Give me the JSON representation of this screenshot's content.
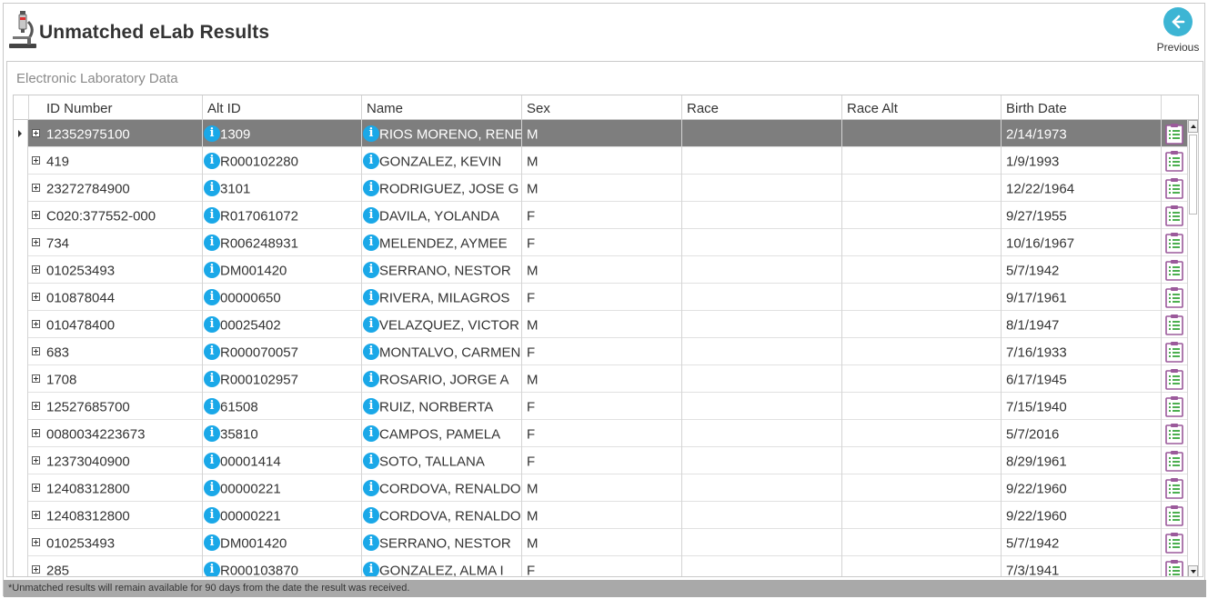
{
  "header": {
    "title": "Unmatched eLab Results",
    "previous_label": "Previous",
    "app_icon": "microscope-icon",
    "previous_icon": "arrow-left-icon"
  },
  "panel": {
    "title": "Electronic Laboratory Data"
  },
  "grid": {
    "columns": [
      "ID Number",
      "Alt ID",
      "Name",
      "Sex",
      "Race",
      "Race Alt",
      "Birth Date"
    ],
    "selected_row": 0,
    "rows": [
      {
        "id": "12352975100",
        "alt_id": "1309",
        "name": "RIOS MORENO, RENE",
        "sex": "M",
        "race": "",
        "race_alt": "",
        "birth": "2/14/1973"
      },
      {
        "id": "419",
        "alt_id": "R000102280",
        "name": "GONZALEZ, KEVIN",
        "sex": "M",
        "race": "",
        "race_alt": "",
        "birth": "1/9/1993"
      },
      {
        "id": "23272784900",
        "alt_id": "3101",
        "name": "RODRIGUEZ, JOSE G",
        "sex": "M",
        "race": "",
        "race_alt": "",
        "birth": "12/22/1964"
      },
      {
        "id": "C020:377552-000",
        "alt_id": "R017061072",
        "name": "DAVILA, YOLANDA",
        "sex": "F",
        "race": "",
        "race_alt": "",
        "birth": "9/27/1955"
      },
      {
        "id": "734",
        "alt_id": "R006248931",
        "name": "MELENDEZ, AYMEE",
        "sex": "F",
        "race": "",
        "race_alt": "",
        "birth": "10/16/1967"
      },
      {
        "id": "010253493",
        "alt_id": "DM001420",
        "name": "SERRANO, NESTOR",
        "sex": "M",
        "race": "",
        "race_alt": "",
        "birth": "5/7/1942"
      },
      {
        "id": "010878044",
        "alt_id": "00000650",
        "name": "RIVERA, MILAGROS",
        "sex": "F",
        "race": "",
        "race_alt": "",
        "birth": "9/17/1961"
      },
      {
        "id": "010478400",
        "alt_id": "00025402",
        "name": "VELAZQUEZ, VICTOR I",
        "sex": "M",
        "race": "",
        "race_alt": "",
        "birth": "8/1/1947"
      },
      {
        "id": "683",
        "alt_id": "R000070057",
        "name": "MONTALVO, CARMEN",
        "sex": "F",
        "race": "",
        "race_alt": "",
        "birth": "7/16/1933"
      },
      {
        "id": "1708",
        "alt_id": "R000102957",
        "name": "ROSARIO, JORGE A",
        "sex": "M",
        "race": "",
        "race_alt": "",
        "birth": "6/17/1945"
      },
      {
        "id": "12527685700",
        "alt_id": "61508",
        "name": "RUIZ, NORBERTA",
        "sex": "F",
        "race": "",
        "race_alt": "",
        "birth": "7/15/1940"
      },
      {
        "id": "0080034223673",
        "alt_id": "35810",
        "name": "CAMPOS, PAMELA",
        "sex": "F",
        "race": "",
        "race_alt": "",
        "birth": "5/7/2016"
      },
      {
        "id": "12373040900",
        "alt_id": "00001414",
        "name": "SOTO, TALLANA",
        "sex": "F",
        "race": "",
        "race_alt": "",
        "birth": "8/29/1961"
      },
      {
        "id": "12408312800",
        "alt_id": "00000221",
        "name": "CORDOVA, RENALDO",
        "sex": "M",
        "race": "",
        "race_alt": "",
        "birth": "9/22/1960"
      },
      {
        "id": "12408312800",
        "alt_id": "00000221",
        "name": "CORDOVA, RENALDO",
        "sex": "M",
        "race": "",
        "race_alt": "",
        "birth": "9/22/1960"
      },
      {
        "id": "010253493",
        "alt_id": "DM001420",
        "name": "SERRANO, NESTOR",
        "sex": "M",
        "race": "",
        "race_alt": "",
        "birth": "5/7/1942"
      },
      {
        "id": "285",
        "alt_id": "R000103870",
        "name": "GONZALEZ, ALMA I",
        "sex": "F",
        "race": "",
        "race_alt": "",
        "birth": "7/3/1941"
      }
    ],
    "info_icon_glyph": "i",
    "row_action_icon": "clipboard-icon"
  },
  "footer": {
    "note": "*Unmatched results will remain available for 90 days from the date the result was received."
  },
  "colors": {
    "accent": "#3db5d4",
    "info": "#1aa8e8",
    "selected_row": "#7e7e7e",
    "clipboard": "#9b5a9b",
    "footer_bar": "#a9a9a9"
  }
}
